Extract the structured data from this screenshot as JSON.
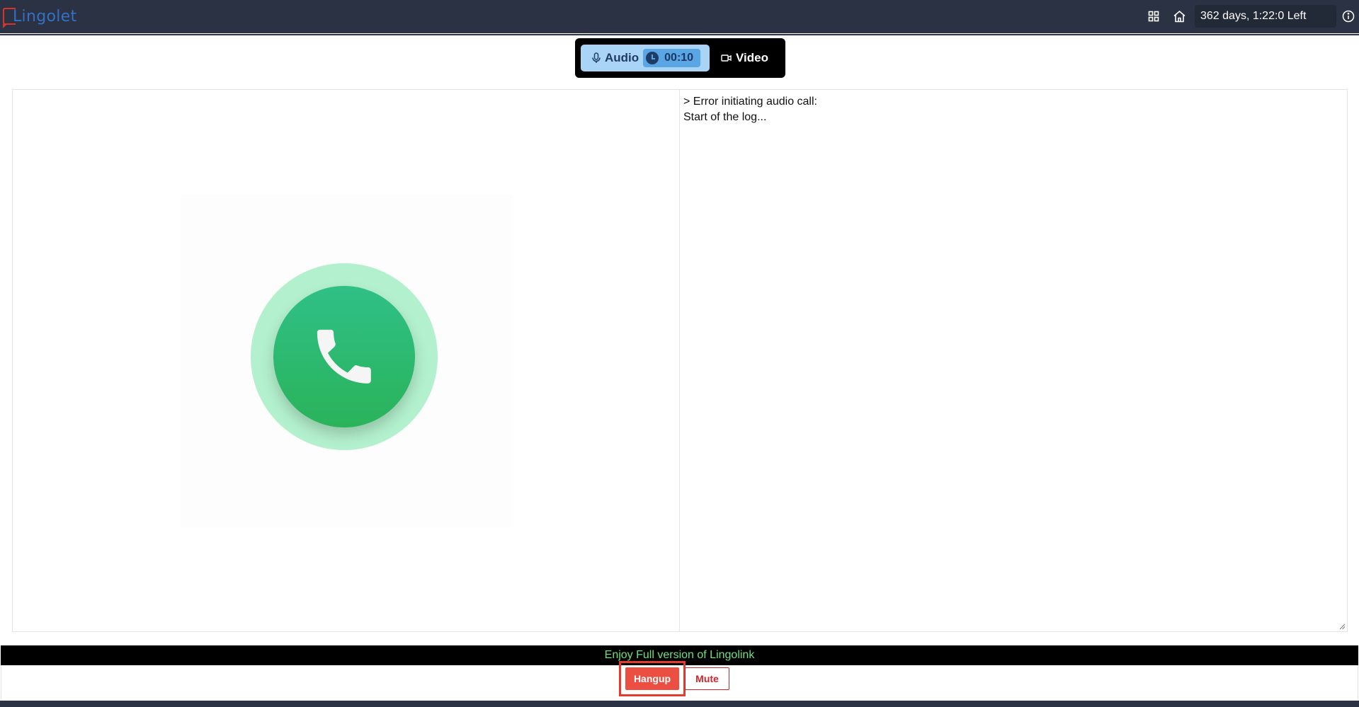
{
  "app": {
    "logo_text": "Lingolet",
    "time_left": "362 days, 1:22:0 Left"
  },
  "topbar": {
    "icons": [
      "grid-icon",
      "home-icon",
      "info-icon"
    ]
  },
  "mode_switch": {
    "audio_label": "Audio",
    "timer": "00:10",
    "video_label": "Video",
    "active": "Audio"
  },
  "log": {
    "lines": [
      "> Error initiating audio call:",
      "Start of the log..."
    ]
  },
  "footer": {
    "promo_text": "Enjoy Full version of Lingolink",
    "hangup_label": "Hangup",
    "mute_label": "Mute"
  },
  "colors": {
    "topbar": "#2a3244",
    "accent_red": "#ea4f42",
    "audio_tab": "#a9d4f5",
    "call_green": "#2ab35a",
    "promo_text": "#6ee07e"
  }
}
